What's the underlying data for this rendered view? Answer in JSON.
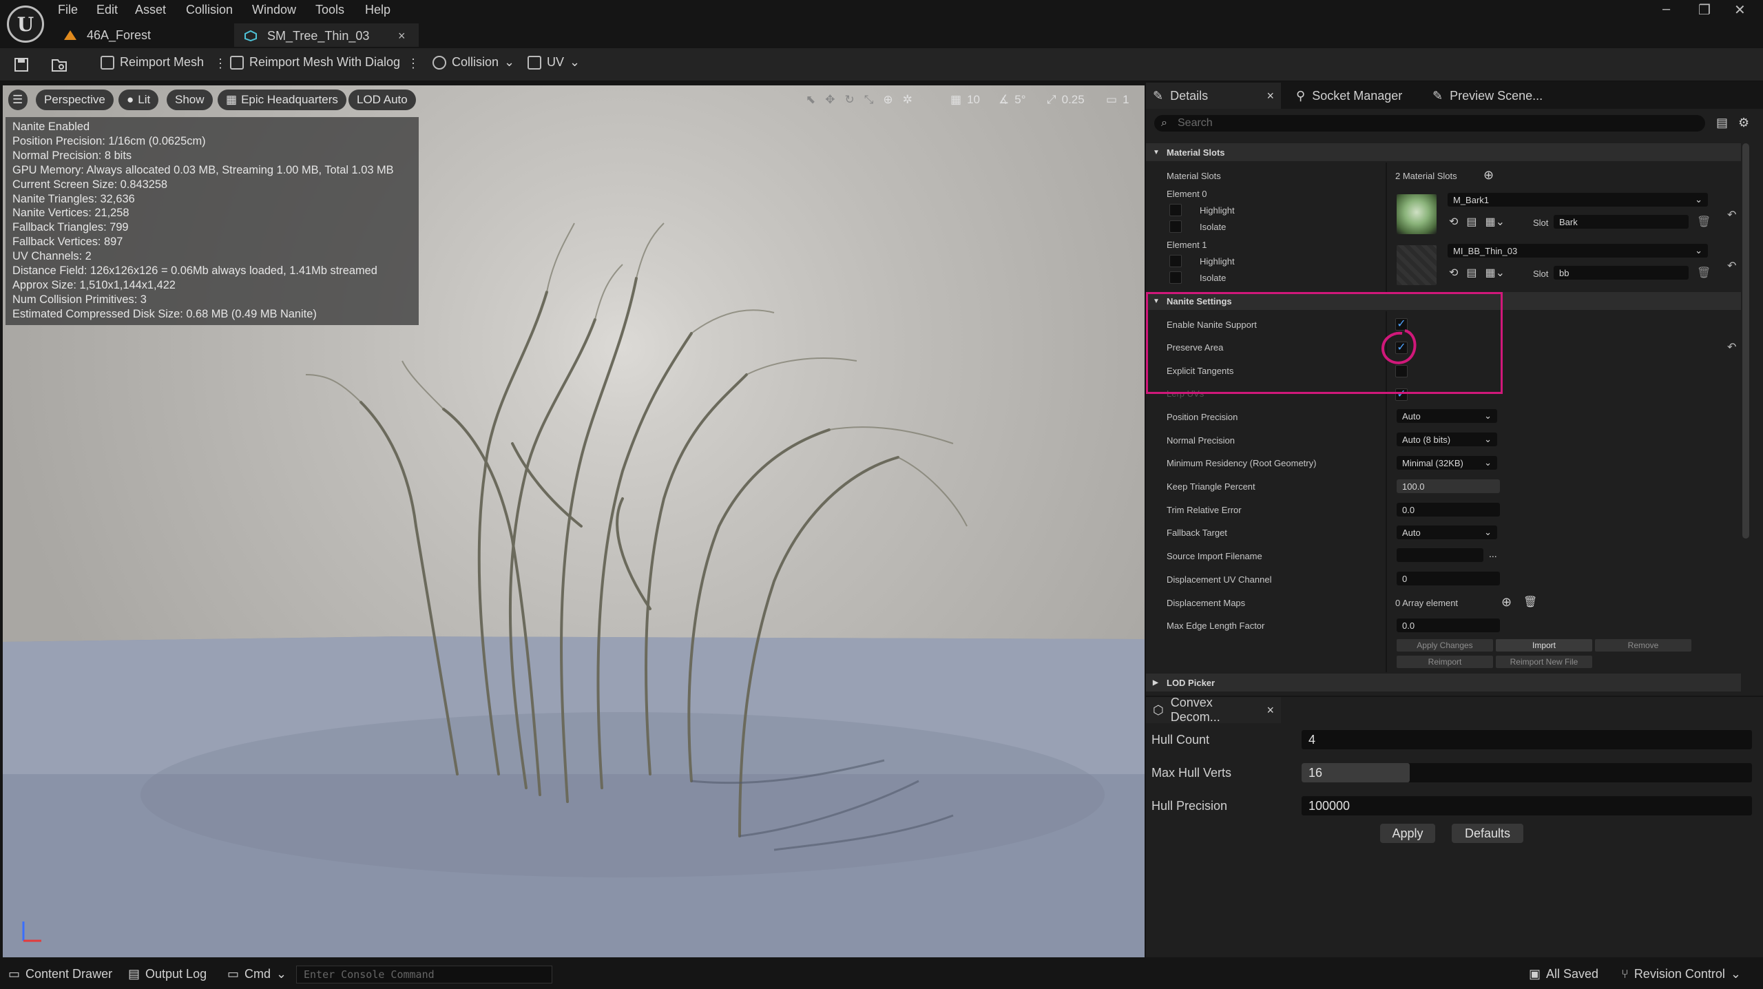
{
  "menubar": {
    "items": [
      "File",
      "Edit",
      "Asset",
      "Collision",
      "Window",
      "Tools",
      "Help"
    ],
    "window_controls": [
      "–",
      "❐",
      "✕"
    ]
  },
  "doc_tabs": [
    {
      "label": "46A_Forest"
    },
    {
      "label": "SM_Tree_Thin_03",
      "close": "×"
    }
  ],
  "toolbar": {
    "reimport_mesh": "Reimport Mesh",
    "reimport_with_dialog": "Reimport Mesh With Dialog",
    "collision": "Collision",
    "uv": "UV"
  },
  "viewport": {
    "perspective": "Perspective",
    "lit": "Lit",
    "show": "Show",
    "environment": "Epic Headquarters",
    "lod": "LOD Auto",
    "grid_snap": "10",
    "rotation_snap": "5°",
    "scale_snap": "0.25",
    "camera_speed": "1",
    "stats": [
      "Nanite Enabled",
      "Position Precision: 1/16cm (0.0625cm)",
      "Normal Precision: 8 bits",
      "GPU Memory: Always allocated 0.03 MB, Streaming 1.00 MB, Total 1.03 MB",
      "Current Screen Size: 0.843258",
      "Nanite Triangles: 32,636",
      "Nanite Vertices: 21,258",
      "Fallback Triangles: 799",
      "Fallback Vertices: 897",
      "UV Channels: 2",
      "Distance Field: 126x126x126 = 0.06Mb always loaded, 1.41Mb streamed",
      "Approx Size: 1,510x1,144x1,422",
      "Num Collision Primitives: 3",
      "Estimated Compressed Disk Size: 0.68 MB (0.49 MB Nanite)"
    ]
  },
  "details": {
    "tabs": [
      "Details",
      "Socket Manager",
      "Preview Scene..."
    ],
    "search_placeholder": "Search",
    "material_slots_header": "Material Slots",
    "material_slots_label": "Material Slots",
    "material_slots_value": "2 Material Slots",
    "elements": [
      {
        "label": "Element 0",
        "material": "M_Bark1",
        "slot_label": "Slot",
        "slot_name": "Bark",
        "highlight": "Highlight",
        "isolate": "Isolate"
      },
      {
        "label": "Element 1",
        "material": "MI_BB_Thin_03",
        "slot_label": "Slot",
        "slot_name": "bb",
        "highlight": "Highlight",
        "isolate": "Isolate"
      }
    ],
    "nanite_header": "Nanite Settings",
    "enable_nanite": "Enable Nanite Support",
    "preserve_area": "Preserve Area",
    "explicit_tangents": "Explicit Tangents",
    "lerp_uvs": "Lerp UVs",
    "position_precision": {
      "label": "Position Precision",
      "value": "Auto"
    },
    "normal_precision": {
      "label": "Normal Precision",
      "value": "Auto (8 bits)"
    },
    "min_residency": {
      "label": "Minimum Residency (Root Geometry)",
      "value": "Minimal (32KB)"
    },
    "keep_triangle": {
      "label": "Keep Triangle Percent",
      "value": "100.0"
    },
    "trim_error": {
      "label": "Trim Relative Error",
      "value": "0.0"
    },
    "fallback_target": {
      "label": "Fallback Target",
      "value": "Auto"
    },
    "source_import": {
      "label": "Source Import Filename",
      "value": "",
      "browse": "..."
    },
    "displacement_uv": {
      "label": "Displacement UV Channel",
      "value": "0"
    },
    "displacement_maps": {
      "label": "Displacement Maps",
      "value": "0 Array element"
    },
    "max_edge": {
      "label": "Max Edge Length Factor",
      "value": "0.0"
    },
    "buttons": {
      "apply_changes": "Apply Changes",
      "import": "Import",
      "remove": "Remove",
      "reimport": "Reimport",
      "reimport_new": "Reimport New File"
    },
    "lod_picker": "LOD Picker"
  },
  "convex": {
    "tab": "Convex Decom...",
    "hull_count": {
      "label": "Hull Count",
      "value": "4"
    },
    "max_hull_verts": {
      "label": "Max Hull Verts",
      "value": "16",
      "slider_fraction": 0.24
    },
    "hull_precision": {
      "label": "Hull Precision",
      "value": "100000"
    },
    "apply": "Apply",
    "defaults": "Defaults"
  },
  "bottombar": {
    "content_drawer": "Content Drawer",
    "output_log": "Output Log",
    "cmd": "Cmd",
    "console_placeholder": "Enter Console Command",
    "all_saved": "All Saved",
    "revision_control": "Revision Control"
  },
  "colors": {
    "accent_highlight": "#d0187a",
    "check_blue": "#4fa3ff"
  }
}
